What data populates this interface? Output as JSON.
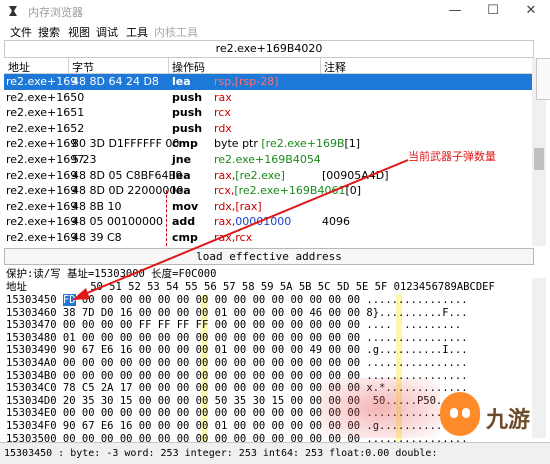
{
  "window": {
    "title": "内存浏览器",
    "min_glyph": "—",
    "max_glyph": "☐",
    "close_glyph": "✕"
  },
  "menu": [
    "文件",
    "搜索",
    "视图",
    "调试",
    "工具",
    "内核工具"
  ],
  "address_bar": "re2.exe+169B4020",
  "disasm_header": {
    "address": "地址",
    "bytes": "字节",
    "opcode": "操作码",
    "comment": "注释"
  },
  "disasm_rows": [
    {
      "addr": "re2.exe+169",
      "bytes": "48 8D 64 24 D8",
      "mnem": "lea",
      "ops": [
        [
          "red",
          "rsp,[rsp-28]"
        ]
      ],
      "comment": "",
      "selected": true
    },
    {
      "addr": "re2.exe+1650",
      "bytes": "",
      "mnem": "push",
      "ops": [
        [
          "red",
          "rax"
        ]
      ],
      "comment": ""
    },
    {
      "addr": "re2.exe+1651",
      "bytes": "",
      "mnem": "push",
      "ops": [
        [
          "red",
          "rcx"
        ]
      ],
      "comment": ""
    },
    {
      "addr": "re2.exe+1652",
      "bytes": "",
      "mnem": "push",
      "ops": [
        [
          "red",
          "rdx"
        ]
      ],
      "comment": ""
    },
    {
      "addr": "re2.exe+169",
      "bytes": "80 3D D1FFFFFF 00",
      "mnem": "cmp",
      "ops": [
        [
          "black",
          "byte ptr "
        ],
        [
          "green",
          "[re2.exe+169B"
        ],
        [
          "black",
          "[1]"
        ]
      ],
      "comment": ""
    },
    {
      "addr": "re2.exe+1697",
      "bytes": "5 23",
      "mnem": "jne",
      "ops": [
        [
          "green",
          "re2.exe+169B4054"
        ]
      ],
      "comment": ""
    },
    {
      "addr": "re2.exe+169",
      "bytes": "48 8D 05 C8BF64E9",
      "mnem": "lea",
      "ops": [
        [
          "red",
          "rax,"
        ],
        [
          "green",
          "[re2.exe]"
        ]
      ],
      "comment": "[00905A4D]"
    },
    {
      "addr": "re2.exe+169",
      "bytes": "48 8D 0D 22000000",
      "mnem": "lea",
      "ops": [
        [
          "red",
          "rcx,"
        ],
        [
          "green",
          "[re2.exe+169B4061"
        ],
        [
          "black",
          "[0]"
        ]
      ],
      "comment": ""
    },
    {
      "addr": "re2.exe+169",
      "bytes": "48 8B 10",
      "mnem": "mov",
      "ops": [
        [
          "red",
          "rdx,[rax]"
        ]
      ],
      "comment": ""
    },
    {
      "addr": "re2.exe+169",
      "bytes": "48 05 00100000",
      "mnem": "add",
      "ops": [
        [
          "red",
          "rax,"
        ],
        [
          "blue",
          "00001000"
        ]
      ],
      "comment": "4096"
    },
    {
      "addr": "re2.exe+169",
      "bytes": "48 39 C8",
      "mnem": "cmp",
      "ops": [
        [
          "red",
          "rax,rcx"
        ]
      ],
      "comment": ""
    }
  ],
  "button_bar": "load effective address",
  "protect_line": "保护:读/写   基址=15303000 长度=F0C000",
  "hex_header": "地址          50 51 52 53 54 55 56 57 58 59 5A 5B 5C 5D 5E 5F 0123456789ABCDEF",
  "hex_rows": [
    {
      "addr": "15303450",
      "first": "FD",
      "bytes": "00 00 00 00 00 00 00 00 00 00 00 00 00 00 00",
      "ascii": "................"
    },
    {
      "addr": "15303460",
      "first": "38",
      "bytes": "7D D0 16 00 00 00 00 01 00 00 00 00 46 00 00",
      "ascii": "8}..........F..."
    },
    {
      "addr": "15303470",
      "first": "00",
      "bytes": "00 00 00 FF FF FF FF 00 00 00 00 00 00 00 00",
      "ascii": "....  ........."
    },
    {
      "addr": "15303480",
      "first": "01",
      "bytes": "00 00 00 00 00 00 00 00 00 00 00 00 00 00 00",
      "ascii": "................"
    },
    {
      "addr": "15303490",
      "first": "90",
      "bytes": "67 E6 16 00 00 00 00 01 00 00 00 00 49 00 00",
      "ascii": ".g..........I..."
    },
    {
      "addr": "153034A0",
      "first": "00",
      "bytes": "00 00 00 00 00 00 00 00 00 00 00 00 00 00 00",
      "ascii": "................"
    },
    {
      "addr": "153034B0",
      "first": "00",
      "bytes": "00 00 00 00 00 00 00 00 00 00 00 00 00 00 00",
      "ascii": "................"
    },
    {
      "addr": "153034C0",
      "first": "78",
      "bytes": "C5 2A 17 00 00 00 00 00 00 00 00 00 00 00 00",
      "ascii": "x.*............."
    },
    {
      "addr": "153034D0",
      "first": "20",
      "bytes": "35 30 15 00 00 00 00 50 35 30 15 00 00 00 00",
      "ascii": " 50.....P50....."
    },
    {
      "addr": "153034E0",
      "first": "00",
      "bytes": "00 00 00 00 00 00 00 00 00 00 00 00 00 00 00",
      "ascii": "................"
    },
    {
      "addr": "153034F0",
      "first": "90",
      "bytes": "67 E6 16 00 00 00 00 01 00 00 00 00 00 00 00",
      "ascii": ".g.............."
    },
    {
      "addr": "15303500",
      "first": "00",
      "bytes": "00 00 00 00 00 00 00 00 00 00 00 00 00 00 00",
      "ascii": "................"
    }
  ],
  "status": "15303450 : byte: -3 word: 253 integer: 253 int64: 253 float:0.00 double:",
  "annotation": "当前武器子弹数量",
  "watermark": "九游",
  "colors": {
    "selection": "#1e78d7",
    "register_red": "#c80000",
    "address_green": "#1a8a1a",
    "annotation_red": "#e01818"
  }
}
